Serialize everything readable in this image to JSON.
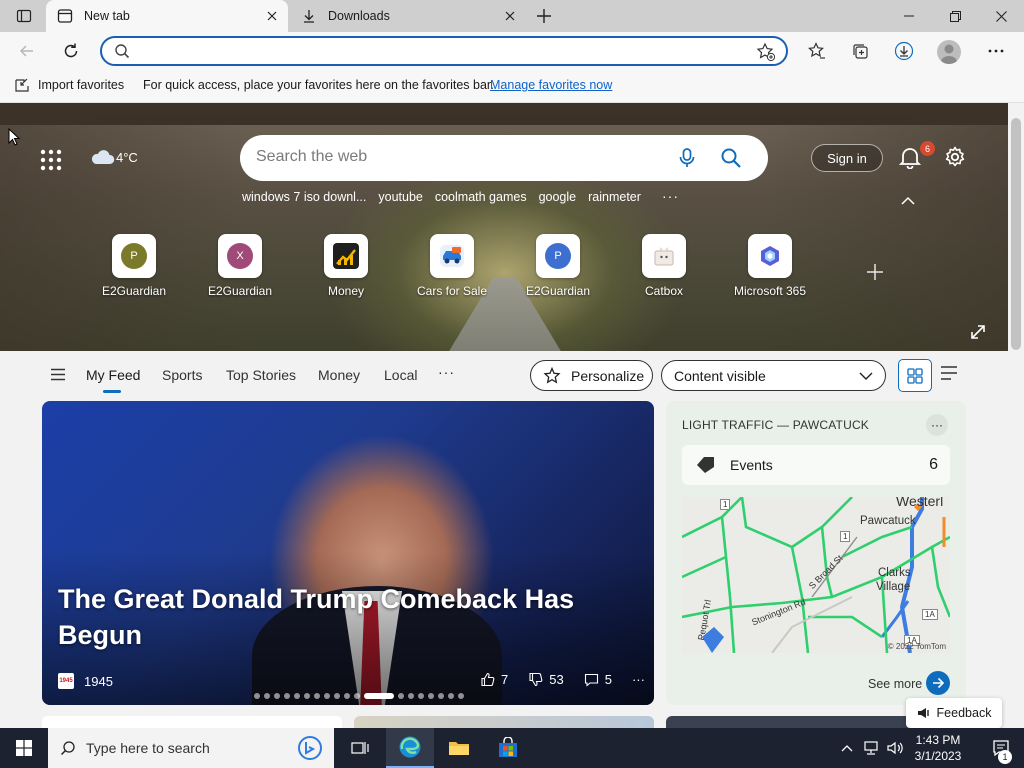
{
  "browser": {
    "tabs": [
      {
        "title": "New tab",
        "active": true,
        "icon": "new-tab-icon"
      },
      {
        "title": "Downloads",
        "active": false,
        "icon": "download-icon"
      }
    ],
    "address": {
      "value": "",
      "placeholder": ""
    },
    "favorites_bar": {
      "import_label": "Import favorites",
      "hint": "For quick access, place your favorites here on the favorites bar.",
      "manage_link": "Manage favorites now"
    }
  },
  "newtab": {
    "weather": {
      "temp": "4°C",
      "icon": "cloud-icon"
    },
    "search": {
      "placeholder": "Search the web"
    },
    "trending": [
      "windows 7 iso downl...",
      "youtube",
      "coolmath games",
      "google",
      "rainmeter"
    ],
    "trending_more": "···",
    "sign_in": "Sign in",
    "notifications_count": "6",
    "quick_links": [
      {
        "label": "E2Guardian",
        "letter": "P",
        "color": "#7a7a2a"
      },
      {
        "label": "E2Guardian",
        "letter": "X",
        "color": "#a04a78"
      },
      {
        "label": "Money",
        "letter": "",
        "color": ""
      },
      {
        "label": "Cars for Sale",
        "letter": "",
        "color": ""
      },
      {
        "label": "E2Guardian",
        "letter": "P",
        "color": "#3d6fd1"
      },
      {
        "label": "Catbox",
        "letter": "",
        "color": ""
      },
      {
        "label": "Microsoft 365",
        "letter": "",
        "color": ""
      }
    ]
  },
  "feed_nav": {
    "tabs": [
      "My Feed",
      "Sports",
      "Top Stories",
      "Money",
      "Local"
    ],
    "more": "···",
    "personalize": "Personalize",
    "content_visibility": "Content visible"
  },
  "story": {
    "title": "The Great Donald Trump Comeback Has Begun",
    "source": "1945",
    "source_logo": "1945",
    "likes": "7",
    "dislikes": "53",
    "comments": "5",
    "more": "···",
    "carousel_count": 19,
    "carousel_active": 11
  },
  "traffic": {
    "title": "LIGHT TRAFFIC — PAWCATUCK",
    "events_label": "Events",
    "events_count": "6",
    "map_labels": [
      "Westerl",
      "Pawcatuck",
      "Clarks",
      "Village",
      "Stonington Rd",
      "S Broad St",
      "Pequot Trl"
    ],
    "route_labels": [
      "1",
      "1A",
      "1A",
      "1"
    ],
    "copyright": "© 2022 TomTom",
    "see_more": "See more"
  },
  "feedback": "Feedback",
  "taskbar": {
    "search_placeholder": "Type here to search",
    "time": "1:43 PM",
    "date": "3/1/2023",
    "notification_count": "1"
  },
  "colors": {
    "accent": "#0f6cbd",
    "omnibox_border": "#1a5fb4",
    "badge": "#d9492e",
    "taskbar": "#1c2230"
  }
}
